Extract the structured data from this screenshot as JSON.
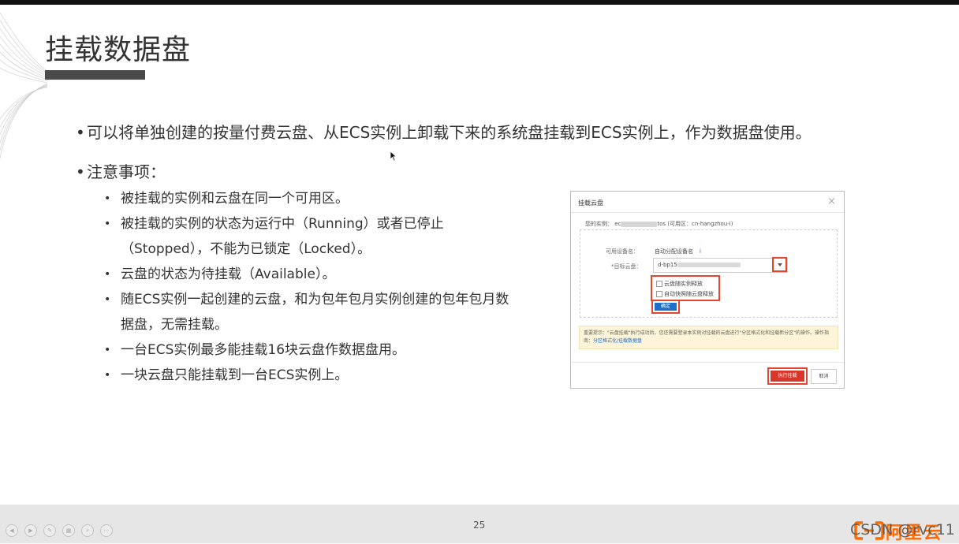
{
  "slide": {
    "title": "挂载数据盘",
    "bullets": [
      "可以将单独创建的按量付费云盘、从ECS实例上卸载下来的系统盘挂载到ECS实例上，作为数据盘使用。",
      "注意事项："
    ],
    "sub_bullets": [
      "被挂载的实例和云盘在同一个可用区。",
      "被挂载的实例的状态为运行中（Running）或者已停止",
      "（Stopped），不能为已锁定（Locked）。",
      "云盘的状态为待挂载（Available）。",
      "随ECS实例一起创建的云盘，和为包年包月实例创建的包年包月数",
      "据盘，无需挂载。",
      "一台ECS实例最多能挂载16块云盘作数据盘用。",
      "一块云盘只能挂载到一台ECS实例上。"
    ],
    "bullet_symbol": "•",
    "page_number": "25"
  },
  "dialog": {
    "title": "挂载云盘",
    "close": "×",
    "instance_label": "您的实例：",
    "instance_prefix": "ec",
    "instance_suffix": "tos (可用区：cn-hangzhou-i)",
    "device_label": "可用设备名：",
    "device_value": "自动分配设备名",
    "device_info": "i",
    "disk_label": "*目标云盘：",
    "disk_value": "d-bp15",
    "checkbox_release_disk": "云盘随实例释放",
    "checkbox_release_snapshot": "自动快照随云盘释放",
    "ok_button": "确定",
    "notice_text": "重要提示：\"云盘挂载\"执行成功后，您还需要登录本实例对挂载的云盘进行\"分区格式化和挂载新分区\"的操作。",
    "notice_link_prefix": "操作指南：",
    "notice_link": "分区格式化/挂载数据盘",
    "execute_button": "执行挂载",
    "cancel_button": "取消"
  },
  "footer": {
    "logo_text": "阿里云",
    "watermark": "CSDN @rvc11"
  },
  "colors": {
    "accent_red": "#e5452f",
    "primary_blue": "#1e6fc9",
    "aliyun_orange": "#ff6a00",
    "title_bar": "#4a4a4a"
  }
}
